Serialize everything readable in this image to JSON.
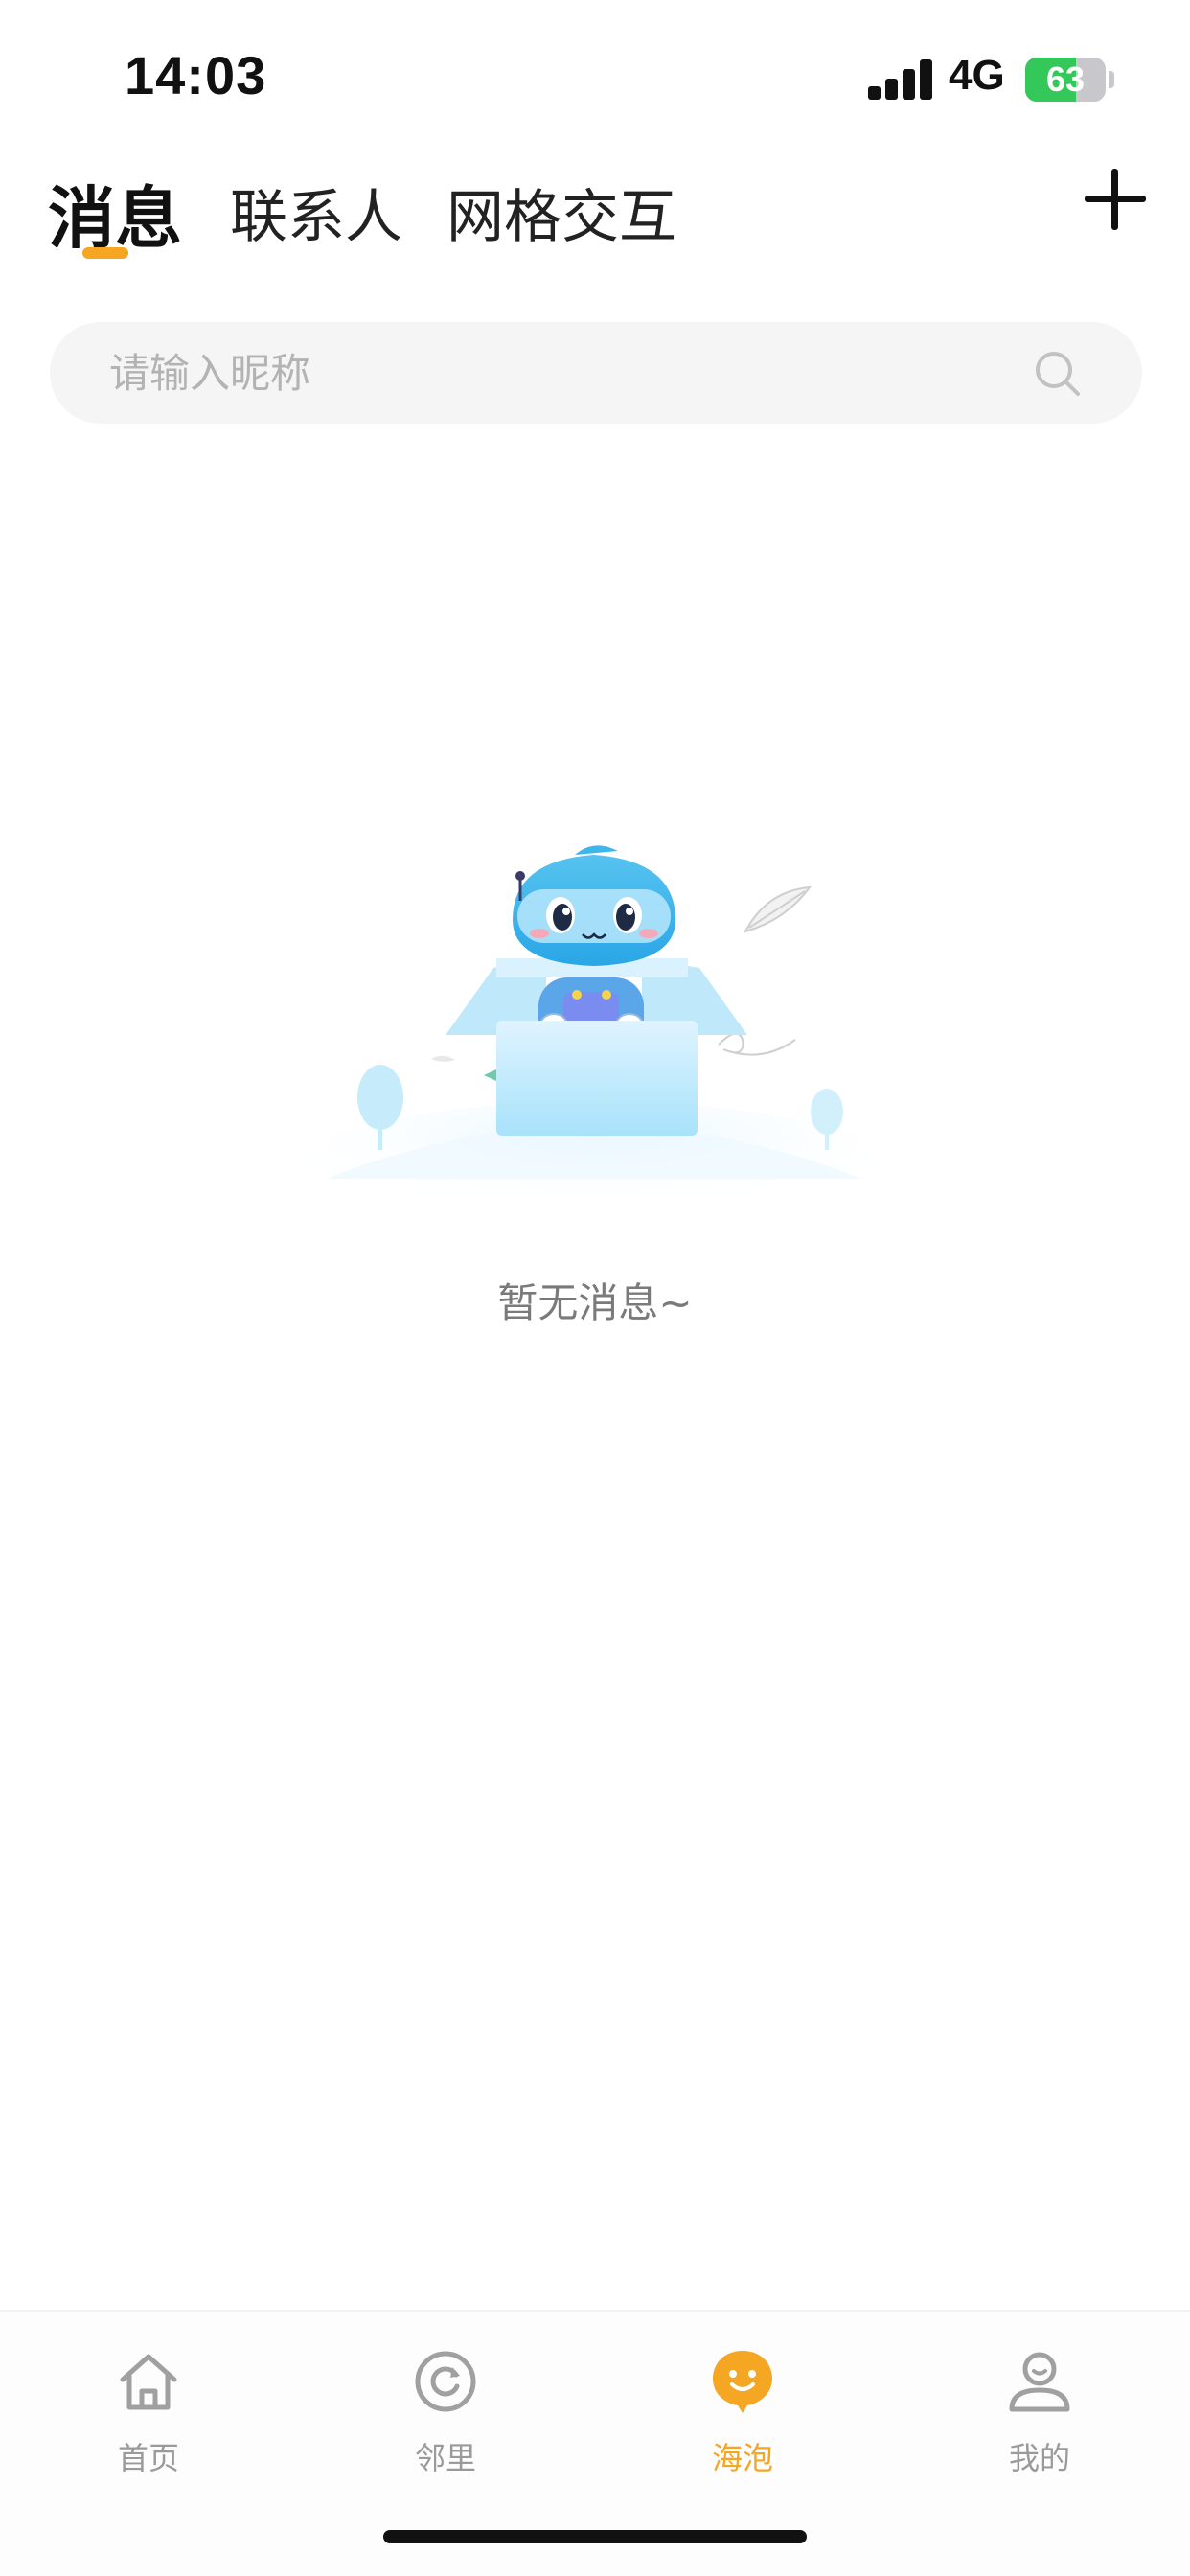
{
  "status_bar": {
    "time": "14:03",
    "network": "4G",
    "battery": "63",
    "battery_level_percent": 63
  },
  "tabs": [
    {
      "label": "消息",
      "active": true
    },
    {
      "label": "联系人",
      "active": false
    },
    {
      "label": "网格交互",
      "active": false
    }
  ],
  "header": {
    "add_icon": "plus-icon"
  },
  "search": {
    "placeholder": "请输入昵称",
    "value": "",
    "icon": "search-icon"
  },
  "empty_state": {
    "message": "暂无消息~",
    "illustration": "robot-in-box-illustration"
  },
  "bottom_nav": [
    {
      "label": "首页",
      "icon": "home-icon",
      "active": false
    },
    {
      "label": "邻里",
      "icon": "refresh-circle-icon",
      "active": false
    },
    {
      "label": "海泡",
      "icon": "bubble-face-icon",
      "active": true
    },
    {
      "label": "我的",
      "icon": "user-icon",
      "active": false
    }
  ],
  "colors": {
    "accent": "#f5a623",
    "battery_green": "#34c759",
    "inactive_gray": "#9a9a9a",
    "search_bg": "#f5f5f5"
  }
}
